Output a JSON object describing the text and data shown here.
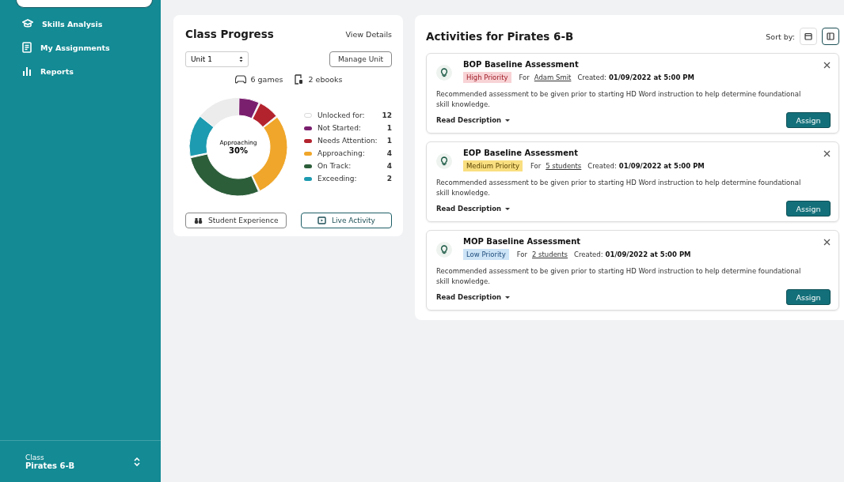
{
  "sidebar": {
    "items": [
      {
        "label": "Skills Analysis"
      },
      {
        "label": "My Assignments"
      },
      {
        "label": "Reports"
      }
    ],
    "class_label": "Class",
    "class_name": "Pirates 6-B"
  },
  "class_progress": {
    "title": "Class Progress",
    "view_details": "View Details",
    "unit": "Unit 1",
    "manage": "Manage Unit",
    "games": "6 games",
    "ebooks": "2 ebooks",
    "center_label": "Approaching",
    "center_value": "30%",
    "legend": [
      {
        "label": "Unlocked for:",
        "count": "12",
        "kind": "outline",
        "color": "#d9d9d9"
      },
      {
        "label": "Not Started:",
        "count": "1",
        "kind": "slice",
        "color": "#7a1f6e"
      },
      {
        "label": "Needs Attention:",
        "count": "1",
        "kind": "slice",
        "color": "#b3232e"
      },
      {
        "label": "Approaching:",
        "count": "4",
        "kind": "slice",
        "color": "#f0a62a"
      },
      {
        "label": "On Track:",
        "count": "4",
        "kind": "slice",
        "color": "#2c5e3a"
      },
      {
        "label": "Exceeding:",
        "count": "2",
        "kind": "slice",
        "color": "#1d9bb0"
      }
    ],
    "buttons": [
      {
        "label": "Student Experience",
        "primary": false
      },
      {
        "label": "Live Activity",
        "primary": true
      }
    ]
  },
  "activities": {
    "title": "Activities for Pirates 6-B",
    "sort_label": "Sort by:",
    "sort_options": [
      {
        "selected": false
      },
      {
        "selected": true
      }
    ],
    "cards": [
      {
        "title": "BOP Baseline Assessment",
        "priority": "High Priority",
        "kind": "high",
        "for_label": "For",
        "for_value": "Adam Smit",
        "created_label": "Created:",
        "created_value": "01/09/2022 at 5:00 PM",
        "description": "Recommended assessment to be given prior to starting HD Word instruction to help determine foundational skill knowledge.",
        "read": "Read Description",
        "assign": "Assign"
      },
      {
        "title": "EOP Baseline Assessment",
        "priority": "Medium Priority",
        "kind": "medium",
        "for_label": "For",
        "for_value": "5 students",
        "created_label": "Created:",
        "created_value": "01/09/2022 at 5:00 PM",
        "description": "Recommended assessment to be given prior to starting HD Word instruction to help determine foundational skill knowledge.",
        "read": "Read Description",
        "assign": "Assign"
      },
      {
        "title": "MOP Baseline Assessment",
        "priority": "Low Priority",
        "kind": "low",
        "for_label": "For",
        "for_value": "2 students",
        "created_label": "Created:",
        "created_value": "01/09/2022 at 5:00 PM",
        "description": "Recommended assessment to be given prior to starting HD Word instruction to help determine foundational skill knowledge.",
        "read": "Read Description",
        "assign": "Assign"
      }
    ]
  }
}
